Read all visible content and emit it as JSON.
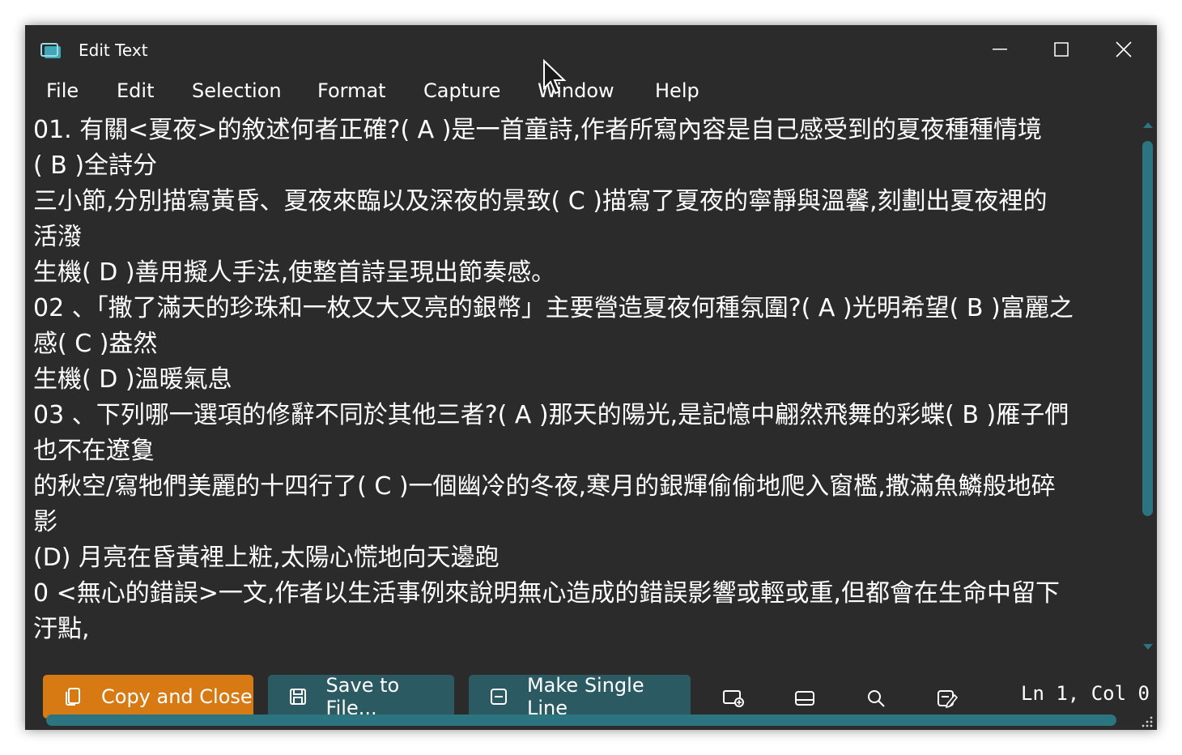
{
  "window": {
    "title": "Edit Text",
    "app_icon": "screen-capture-icon",
    "controls": [
      "minimize-icon",
      "maximize-icon",
      "close-icon"
    ]
  },
  "menu": {
    "items": [
      "File",
      "Edit",
      "Selection",
      "Format",
      "Capture",
      "Window",
      "Help"
    ]
  },
  "editor": {
    "lines": [
      "01. 有關<夏夜>的敘述何者正確?( A )是一首童詩,作者所寫內容是自己感受到的夏夜種種情境",
      "( B )全詩分",
      "三小節,分別描寫黃昏、夏夜來臨以及深夜的景致( C )描寫了夏夜的寧靜與溫馨,刻劃出夏夜裡的",
      "活潑",
      "生機( D )善用擬人手法,使整首詩呈現出節奏感。",
      "02 、「撒了滿天的珍珠和一枚又大又亮的銀幣」主要營造夏夜何種氛圍?( A )光明希望( B )富麗之",
      "感( C )盎然",
      "生機( D )溫暖氣息",
      "03 、下列哪一選項的修辭不同於其他三者?( A )那天的陽光,是記憶中翩然飛舞的彩蝶( B )雁子們",
      "也不在遼敻",
      "的秋空/寫牠們美麗的十四行了( C )一個幽冷的冬夜,寒月的銀輝偷偷地爬入窗檻,撒滿魚鱗般地碎",
      "影",
      "(D) 月亮在昏黃裡上粧,太陽心慌地向天邊跑",
      "0 <無心的錯誤>一文,作者以生活事例來說明無心造成的錯誤影響或輕或重,但都會在生命中留下",
      "汙點,"
    ]
  },
  "toolbar": {
    "copy_close": {
      "label": "Copy and Close",
      "icon": "copy-icon"
    },
    "save_file": {
      "label": "Save to File...",
      "icon": "save-icon"
    },
    "single_line": {
      "label": "Make Single Line",
      "icon": "single-line-icon"
    },
    "tools": [
      "new-capture-icon",
      "grab-text-icon",
      "search-icon",
      "edit-bottom-bar-icon"
    ]
  },
  "status": {
    "cursor_position": "Ln 1, Col 0"
  },
  "colors": {
    "background": "#2b2b2b",
    "accent_orange": "#d87a14",
    "accent_teal": "#2b5a63",
    "scrollbar": "#2b7480",
    "text": "#ffffff"
  }
}
